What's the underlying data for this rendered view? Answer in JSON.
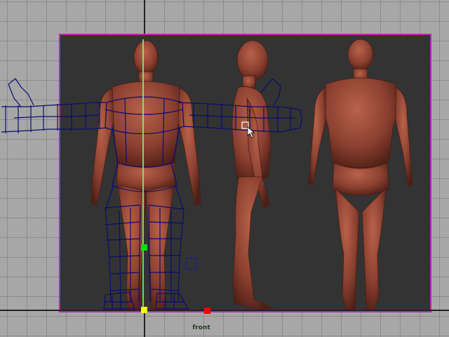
{
  "viewport": {
    "camera_label": "front",
    "colors": {
      "background": "#a7a7a7",
      "grid_line": "#787878",
      "image_plane_border": "#b02bb0",
      "image_plane_fill": "#333333",
      "wireframe": "#0c0c72",
      "body_skin": "#8b4030",
      "manipulator_line": "#7dff7d",
      "manipulator_handle": "#00e000",
      "pivot_handle": "#ffff00",
      "control_red": "#ff0000",
      "selection_box": "#24246e"
    },
    "icons": [
      "select-cursor-icon"
    ]
  }
}
